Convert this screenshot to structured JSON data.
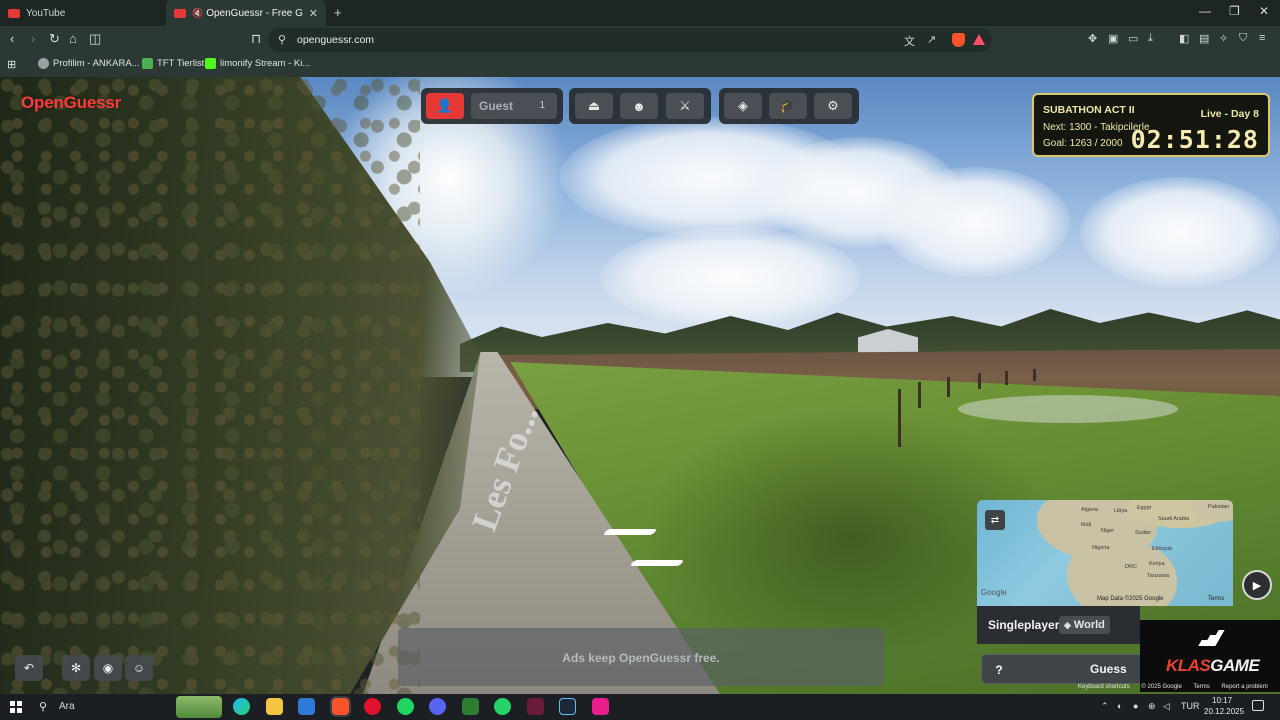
{
  "browser": {
    "tabs": [
      {
        "title": "YouTube",
        "active": false
      },
      {
        "title": "OpenGuessr - Free GeoGuessr",
        "active": true
      }
    ],
    "new_tab_label": "+",
    "url": "openguessr.com",
    "bookmarks": [
      {
        "label": "Profilim - ANKARA...",
        "color": "#9aa0a6"
      },
      {
        "label": "TFT Tierlist",
        "color": "#4caf50"
      },
      {
        "label": "limonify Stream - Ki...",
        "color": "#53fc18"
      }
    ]
  },
  "game": {
    "brand": "OpenGuessr",
    "player": {
      "name": "Guest",
      "count": "1"
    },
    "mode": {
      "label": "Singleplayer",
      "map": "World"
    },
    "guess_label": "Guess",
    "hint_label": "?",
    "ad_text": "Ads keep OpenGuessr free.",
    "road_text": "Les Fo...",
    "minimap": {
      "labels": [
        "Algeria",
        "Libya",
        "Egypt",
        "Saudi Arabia",
        "Pakistan",
        "Mali",
        "Niger",
        "Sudan",
        "Nigeria",
        "Ethiopia",
        "DRC",
        "Kenya",
        "Tanzania"
      ],
      "attribution": "Map Data ©2025 Google",
      "terms": "Terms",
      "google": "Google"
    },
    "footer": [
      "Keyboard shortcuts",
      "© 2025 Google",
      "Terms",
      "Report a problem"
    ]
  },
  "overlay": {
    "subathon": {
      "title": "SUBATHON ACT II",
      "live": "Live - Day 8",
      "next": "Next: 1300 - Takipcilerle",
      "goal": "Goal: 1263 / 2000",
      "timer": "02:51:28"
    },
    "sponsor": {
      "part_a": "KLAS",
      "part_b": "GAME"
    }
  },
  "taskbar": {
    "search_label": "Ara",
    "language": "TUR",
    "time": "10:17",
    "date": "20.12.2025"
  },
  "colors": {
    "brand_red": "#ff3b3b",
    "accent_red": "#e53935",
    "subathon_gold": "#d8c870"
  }
}
